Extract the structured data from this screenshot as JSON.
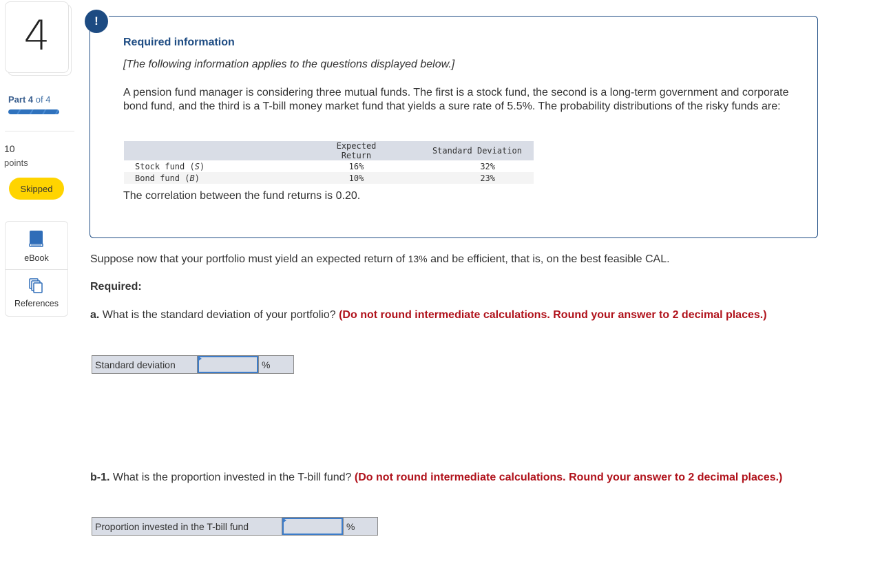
{
  "sidebar": {
    "question_number": "4",
    "part": {
      "prefix": "Part",
      "current": "4",
      "of_text": "of 4",
      "progress_fraction": 1.0
    },
    "points": {
      "value": "10",
      "label": "points"
    },
    "status_badge": "Skipped",
    "tools": [
      {
        "label": "eBook",
        "icon": "book-icon"
      },
      {
        "label": "References",
        "icon": "references-icon"
      }
    ]
  },
  "info_box": {
    "badge": "!",
    "title": "Required information",
    "subtitle": "[The following information applies to the questions displayed below.]",
    "scenario": "A pension fund manager is considering three mutual funds. The first is a stock fund, the second is a long-term government and corporate bond fund, and the third is a T-bill money market fund that yields a sure rate of 5.5%. The probability distributions of the risky funds are:",
    "table": {
      "headers": [
        "",
        "Expected Return",
        "Standard Deviation"
      ],
      "rows": [
        {
          "name": "Stock fund (",
          "symbol": "S",
          "close": ")",
          "expected_return": "16%",
          "std_dev": "32%"
        },
        {
          "name": "Bond fund (",
          "symbol": "B",
          "close": ")",
          "expected_return": "10%",
          "std_dev": "23%"
        }
      ]
    },
    "correlation": "The correlation between the fund returns is 0.20."
  },
  "main": {
    "suppose_pre": "Suppose now that your portfolio must yield an expected return of ",
    "suppose_value": "13%",
    "suppose_post": " and be efficient, that is, on the best feasible CAL.",
    "required_heading": "Required:",
    "questions": [
      {
        "number": "a.",
        "text": " What is the standard deviation of your portfolio? ",
        "instruction": "(Do not round intermediate calculations. Round your answer to 2 decimal places.)",
        "answer_label": "Standard deviation",
        "answer_value": "",
        "answer_unit": "%"
      },
      {
        "number": "b-1.",
        "text": " What is the proportion invested in the T-bill fund? ",
        "instruction": "(Do not round intermediate calculations. Round your answer to 2 decimal places.)",
        "answer_label": "Proportion invested in the T-bill fund",
        "answer_value": "",
        "answer_unit": "%"
      }
    ]
  },
  "colors": {
    "brand_blue": "#1d4b82",
    "instruction_red": "#b0121b",
    "skipped_yellow": "#ffd400",
    "progress_blue": "#2f72bd"
  }
}
